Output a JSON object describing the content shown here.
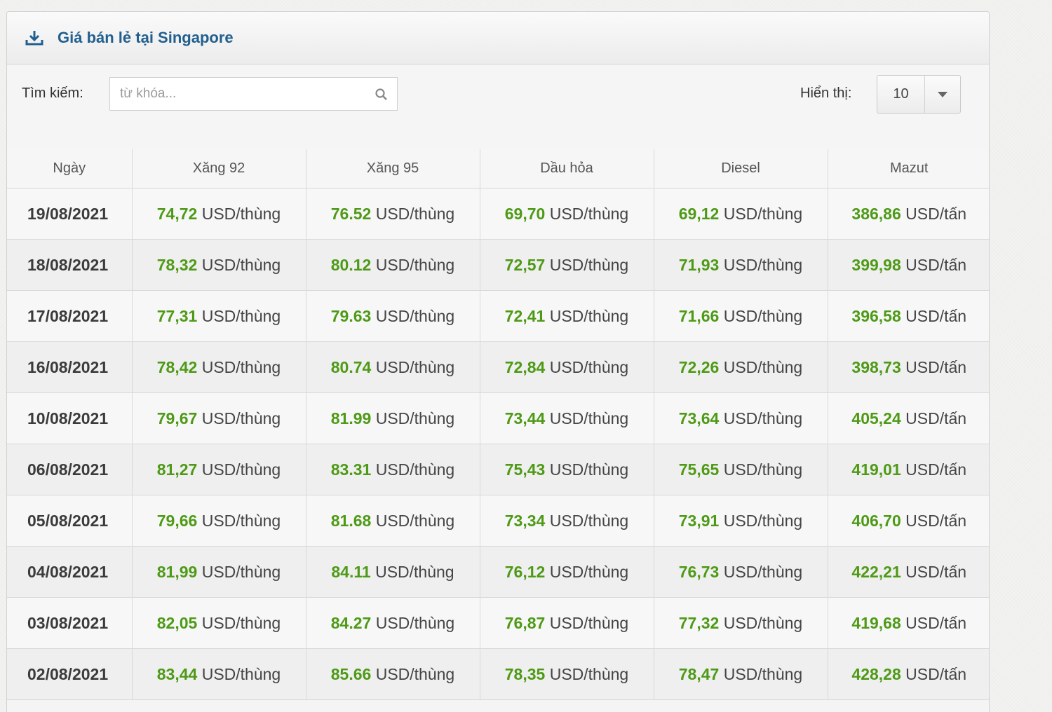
{
  "panel": {
    "title": "Giá bán lẻ tại Singapore"
  },
  "toolbar": {
    "search_label": "Tìm kiếm:",
    "search_placeholder": "từ khóa...",
    "show_label": "Hiển thị:",
    "show_value": "10"
  },
  "table": {
    "headers": [
      "Ngày",
      "Xăng 92",
      "Xăng 95",
      "Dầu hỏa",
      "Diesel",
      "Mazut"
    ],
    "unit_barrel": "USD/thùng",
    "unit_ton": "USD/tấn",
    "rows": [
      {
        "date": "19/08/2021",
        "x92": "74,72",
        "x95": "76.52",
        "dauhoa": "69,70",
        "diesel": "69,12",
        "mazut": "386,86"
      },
      {
        "date": "18/08/2021",
        "x92": "78,32",
        "x95": "80.12",
        "dauhoa": "72,57",
        "diesel": "71,93",
        "mazut": "399,98"
      },
      {
        "date": "17/08/2021",
        "x92": "77,31",
        "x95": "79.63",
        "dauhoa": "72,41",
        "diesel": "71,66",
        "mazut": "396,58"
      },
      {
        "date": "16/08/2021",
        "x92": "78,42",
        "x95": "80.74",
        "dauhoa": "72,84",
        "diesel": "72,26",
        "mazut": "398,73"
      },
      {
        "date": "10/08/2021",
        "x92": "79,67",
        "x95": "81.99",
        "dauhoa": "73,44",
        "diesel": "73,64",
        "mazut": "405,24"
      },
      {
        "date": "06/08/2021",
        "x92": "81,27",
        "x95": "83.31",
        "dauhoa": "75,43",
        "diesel": "75,65",
        "mazut": "419,01"
      },
      {
        "date": "05/08/2021",
        "x92": "79,66",
        "x95": "81.68",
        "dauhoa": "73,34",
        "diesel": "73,91",
        "mazut": "406,70"
      },
      {
        "date": "04/08/2021",
        "x92": "81,99",
        "x95": "84.11",
        "dauhoa": "76,12",
        "diesel": "76,73",
        "mazut": "422,21"
      },
      {
        "date": "03/08/2021",
        "x92": "82,05",
        "x95": "84.27",
        "dauhoa": "76,87",
        "diesel": "77,32",
        "mazut": "419,68"
      },
      {
        "date": "02/08/2021",
        "x92": "83,44",
        "x95": "85.66",
        "dauhoa": "78,35",
        "diesel": "78,47",
        "mazut": "428,28"
      }
    ]
  },
  "colors": {
    "title": "#225f8e",
    "value_green": "#4e9a16"
  },
  "icons": {
    "header": "download-icon",
    "search": "search-icon",
    "select": "caret-down-icon"
  }
}
